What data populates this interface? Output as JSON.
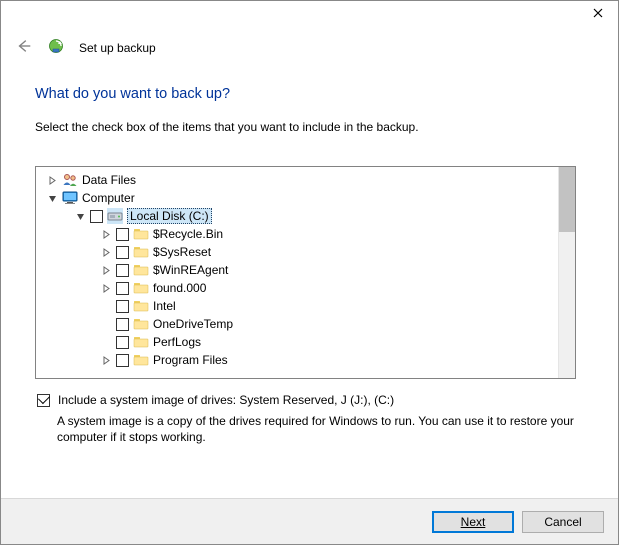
{
  "window": {
    "title": "Set up backup"
  },
  "main": {
    "heading": "What do you want to back up?",
    "instruction": "Select the check box of the items that you want to include in the backup."
  },
  "tree": {
    "data_files": {
      "label": "Data Files"
    },
    "computer": {
      "label": "Computer"
    },
    "local_disk": {
      "label": "Local Disk (C:)"
    },
    "folders": [
      {
        "label": "$Recycle.Bin",
        "expandable": true
      },
      {
        "label": "$SysReset",
        "expandable": true
      },
      {
        "label": "$WinREAgent",
        "expandable": true
      },
      {
        "label": "found.000",
        "expandable": true
      },
      {
        "label": "Intel",
        "expandable": false
      },
      {
        "label": "OneDriveTemp",
        "expandable": false
      },
      {
        "label": "PerfLogs",
        "expandable": false
      },
      {
        "label": "Program Files",
        "expandable": true
      }
    ]
  },
  "system_image": {
    "checkbox_label": "Include a system image of drives: System Reserved, J (J:), (C:)",
    "help": "A system image is a copy of the drives required for Windows to run. You can use it to restore your computer if it stops working."
  },
  "buttons": {
    "next": "Next",
    "cancel": "Cancel"
  }
}
